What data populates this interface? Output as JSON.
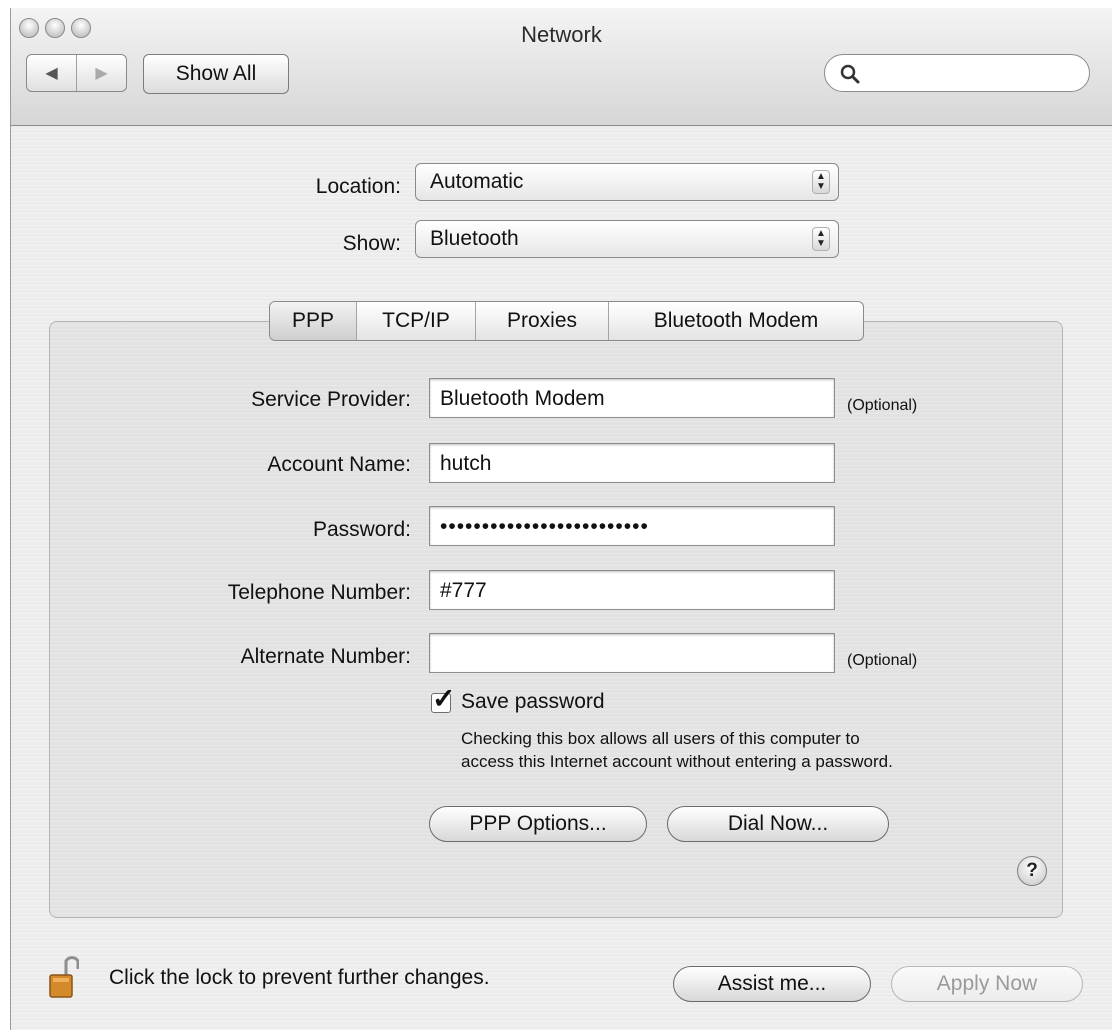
{
  "window": {
    "title": "Network"
  },
  "toolbar": {
    "back_glyph": "◀",
    "forward_glyph": "▶",
    "show_all_label": "Show All",
    "search_placeholder": ""
  },
  "location": {
    "label": "Location:",
    "value": "Automatic"
  },
  "show": {
    "label": "Show:",
    "value": "Bluetooth"
  },
  "tabs": [
    {
      "label": "PPP",
      "selected": true
    },
    {
      "label": "TCP/IP",
      "selected": false
    },
    {
      "label": "Proxies",
      "selected": false
    },
    {
      "label": "Bluetooth Modem",
      "selected": false
    }
  ],
  "form": {
    "service_provider": {
      "label": "Service Provider:",
      "value": "Bluetooth Modem",
      "note": "(Optional)"
    },
    "account_name": {
      "label": "Account Name:",
      "value": "hutch"
    },
    "password": {
      "label": "Password:",
      "value": "•••••••••••••••••••••••••"
    },
    "telephone": {
      "label": "Telephone Number:",
      "value": "#777"
    },
    "alternate": {
      "label": "Alternate Number:",
      "value": "",
      "note": "(Optional)"
    }
  },
  "save_password": {
    "checked": true,
    "label": "Save password",
    "help_line1": "Checking this box allows all users of this computer to",
    "help_line2": "access this Internet account without entering a password."
  },
  "buttons": {
    "ppp_options": "PPP Options...",
    "dial_now": "Dial Now...",
    "help": "?",
    "assist_me": "Assist me...",
    "apply_now": "Apply Now"
  },
  "lock": {
    "text": "Click the lock to prevent further changes."
  },
  "icons": {
    "search": "search-icon",
    "lock": "unlocked-padlock-icon",
    "checkmark": "checkmark-icon"
  }
}
